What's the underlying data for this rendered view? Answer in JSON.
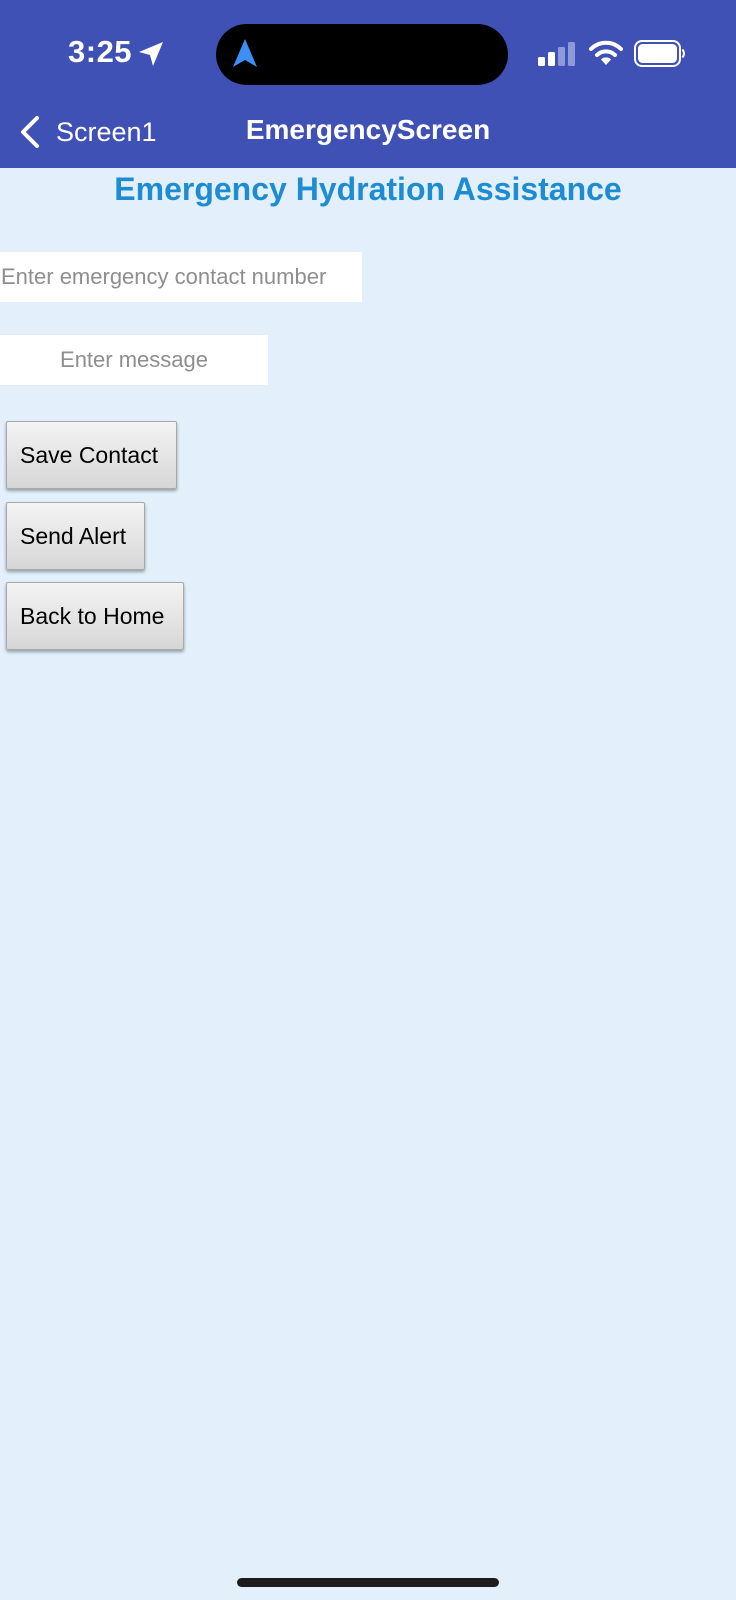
{
  "status_bar": {
    "time": "3:25",
    "icons": [
      "location-arrow-icon",
      "navigation-icon",
      "cellular-signal-icon",
      "wifi-icon",
      "battery-icon"
    ]
  },
  "nav_bar": {
    "back_label": "Screen1",
    "title": "EmergencyScreen",
    "background_color": "#3f51b5"
  },
  "page": {
    "title": "Emergency Hydration Assistance",
    "title_color": "#1e8cd2",
    "background_color": "#e3f0fb"
  },
  "form": {
    "contact_placeholder": "Enter emergency contact number",
    "contact_value": "",
    "message_placeholder": "Enter message",
    "message_value": ""
  },
  "buttons": {
    "save_contact": "Save Contact",
    "send_alert": "Send Alert",
    "back_home": "Back to Home"
  }
}
